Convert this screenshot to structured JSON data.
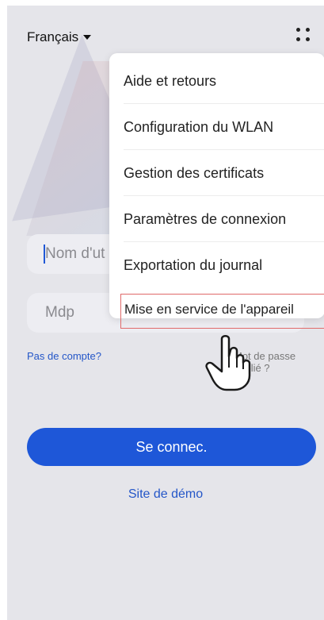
{
  "header": {
    "language": "Français"
  },
  "menu": {
    "items": [
      {
        "label": "Aide et retours"
      },
      {
        "label": "Configuration du WLAN"
      },
      {
        "label": "Gestion des certificats"
      },
      {
        "label": "Paramètres de connexion"
      },
      {
        "label": "Exportation du journal"
      },
      {
        "label": "Mise en service de l'appareil"
      }
    ]
  },
  "form": {
    "username_placeholder": "Nom d'ut",
    "password_placeholder": "Mdp",
    "no_account": "Pas de compte?",
    "forgot": "Mot de passe oublié ?",
    "login_button": "Se connec.",
    "demo_link": "Site de démo"
  },
  "colors": {
    "accent": "#1e57d8",
    "link": "#2456c8",
    "highlight": "#e06a6a"
  },
  "icons": {
    "more": "more-dots-icon",
    "pointer": "hand-pointer-icon"
  }
}
